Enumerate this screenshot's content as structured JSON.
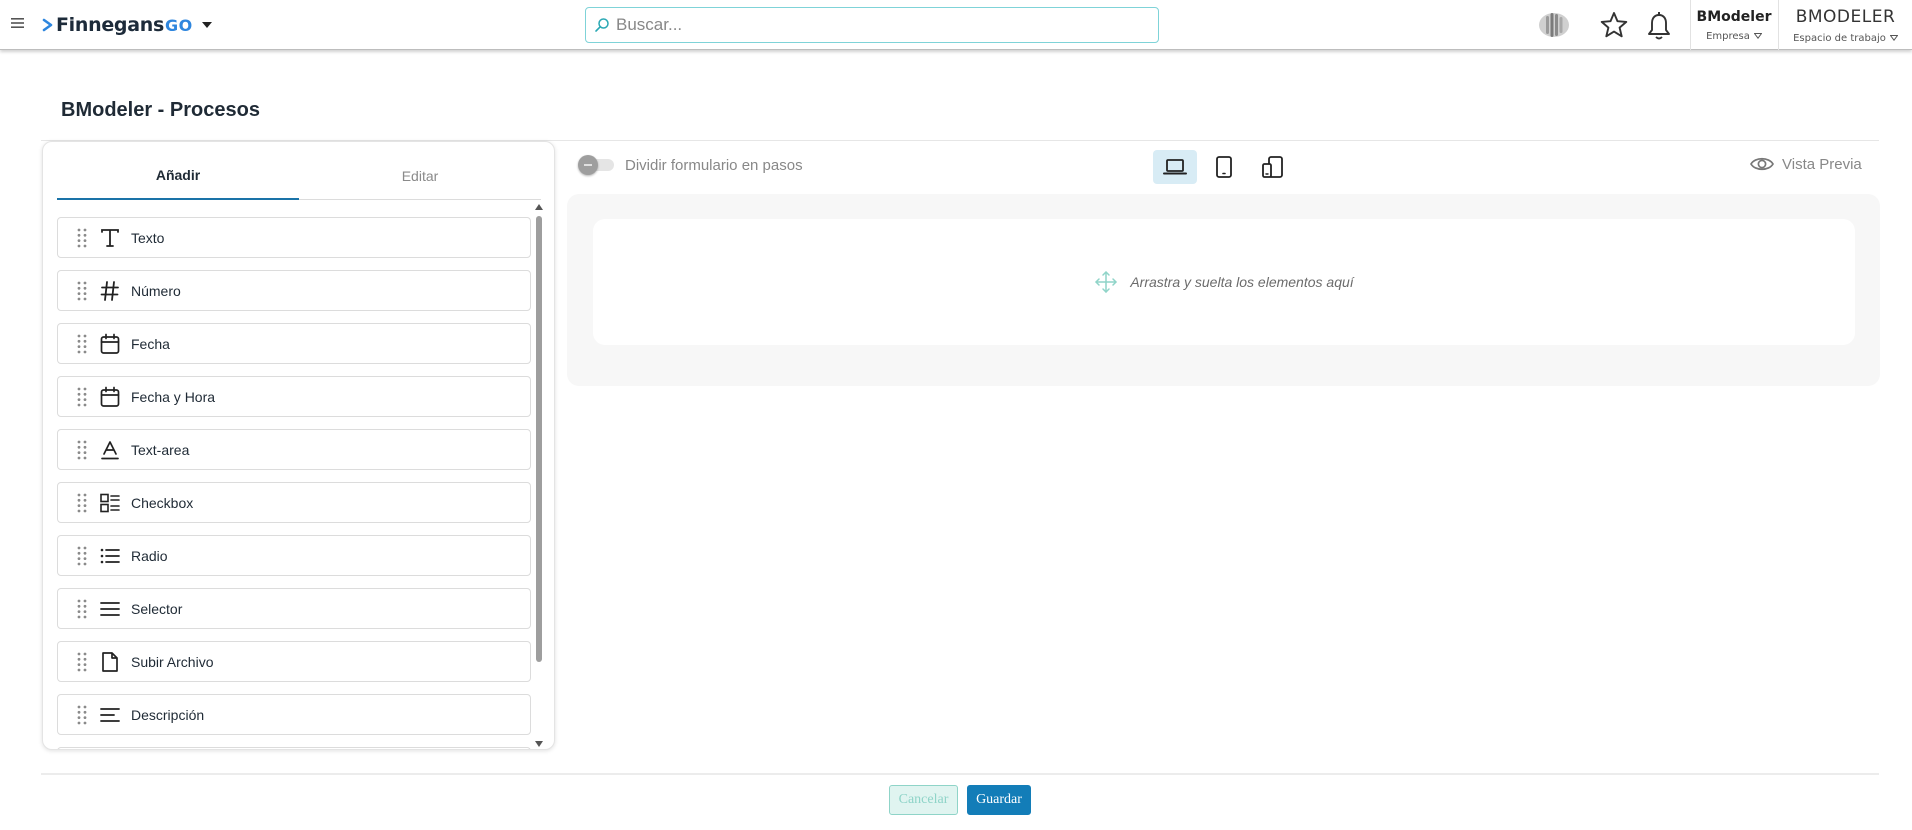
{
  "header": {
    "brand": {
      "name": "Finnegans",
      "suffix": "GO"
    },
    "search": {
      "placeholder": "Buscar..."
    },
    "company": {
      "name": "BModeler",
      "label": "Empresa"
    },
    "workspace": {
      "name": "BMODELER",
      "label": "Espacio de trabajo"
    }
  },
  "page": {
    "title": "BModeler - Procesos"
  },
  "left_panel": {
    "tabs": [
      {
        "label": "Añadir",
        "active": true
      },
      {
        "label": "Editar",
        "active": false
      }
    ],
    "items": [
      {
        "label": "Texto",
        "icon": "text-t-icon"
      },
      {
        "label": "Número",
        "icon": "hash-icon"
      },
      {
        "label": "Fecha",
        "icon": "calendar-icon"
      },
      {
        "label": "Fecha y Hora",
        "icon": "calendar-icon"
      },
      {
        "label": "Text-area",
        "icon": "text-area-icon"
      },
      {
        "label": "Checkbox",
        "icon": "checkbox-list-icon"
      },
      {
        "label": "Radio",
        "icon": "list-icon"
      },
      {
        "label": "Selector",
        "icon": "menu-lines-icon"
      },
      {
        "label": "Subir Archivo",
        "icon": "file-icon"
      },
      {
        "label": "Descripción",
        "icon": "align-left-icon"
      }
    ]
  },
  "builder": {
    "toggle_label": "Dividir formulario en pasos",
    "toggle_on": false,
    "preview_label": "Vista Previa",
    "drop_hint": "Arrastra y suelta los elementos aquí",
    "selected_device": "laptop"
  },
  "footer": {
    "cancel_label": "Cancelar",
    "save_label": "Guardar"
  },
  "colors": {
    "accent": "#137db8",
    "tab_underline": "#1a73a8",
    "search_border": "#7fd3d8",
    "cancel_text": "#8fd4c8",
    "device_selected_bg": "#d8ecf5"
  }
}
